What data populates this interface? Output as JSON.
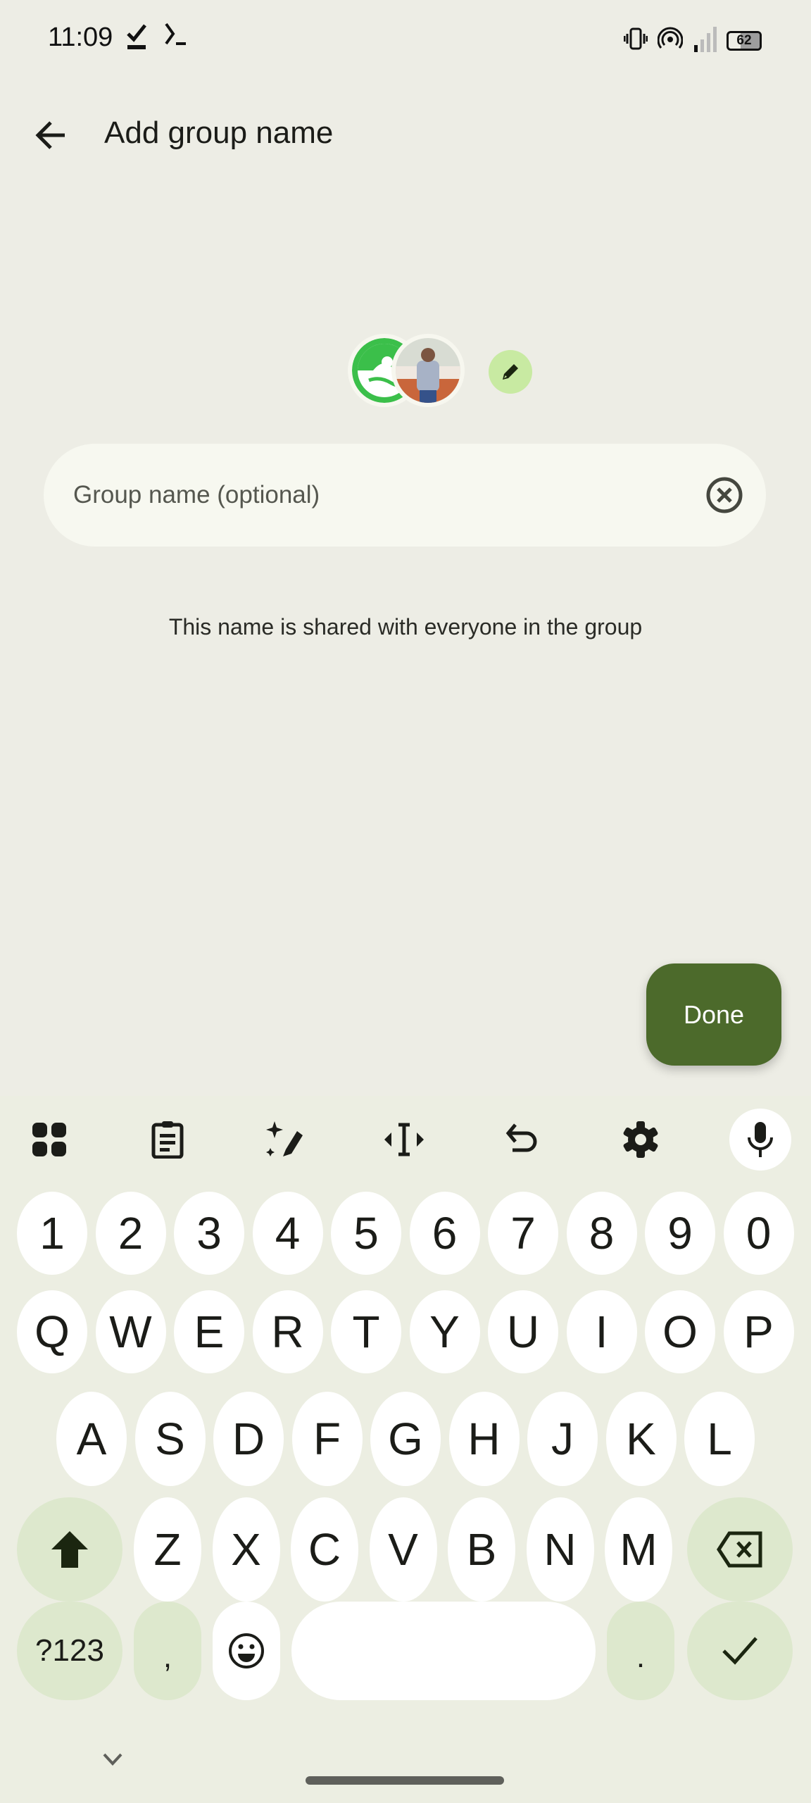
{
  "status_bar": {
    "time": "11:09",
    "left_icons": [
      "task-check-icon",
      "terminal-icon"
    ],
    "right_icons": [
      "vibrate-icon",
      "hotspot-icon",
      "signal-icon",
      "battery-icon"
    ],
    "battery_level": "62"
  },
  "app_bar": {
    "back_icon": "arrow-back-icon",
    "title": "Add group name"
  },
  "avatars": [
    {
      "name": "app-logo-avatar",
      "description": "green robot logo"
    },
    {
      "name": "person-photo-avatar",
      "description": "photo of person"
    }
  ],
  "edit_photo": {
    "icon": "pencil-icon"
  },
  "group_name_field": {
    "value": "",
    "placeholder": "Group name (optional)",
    "clear_icon": "clear-circle-icon"
  },
  "helper_text": "This name is shared with everyone in the group",
  "done_button": {
    "label": "Done"
  },
  "colors": {
    "background": "#edede5",
    "accent": "#4c6a2b",
    "edit_button": "#c8eaa2",
    "key_fn": "#dde8cd",
    "field_bg": "#f7f8f0"
  },
  "keyboard": {
    "toolbar": [
      "apps-grid-icon",
      "clipboard-icon",
      "magic-edit-icon",
      "text-cursor-icon",
      "undo-icon",
      "settings-gear-icon",
      "microphone-icon"
    ],
    "row_numbers": [
      "1",
      "2",
      "3",
      "4",
      "5",
      "6",
      "7",
      "8",
      "9",
      "0"
    ],
    "row_1": [
      "Q",
      "W",
      "E",
      "R",
      "T",
      "Y",
      "U",
      "I",
      "O",
      "P"
    ],
    "row_2": [
      "A",
      "S",
      "D",
      "F",
      "G",
      "H",
      "J",
      "K",
      "L"
    ],
    "row_3": [
      "Z",
      "X",
      "C",
      "V",
      "B",
      "N",
      "M"
    ],
    "shift_icon": "shift-arrow-icon",
    "backspace_icon": "backspace-icon",
    "symbols_label": "?123",
    "comma_label": ",",
    "emoji_icon": "emoji-icon",
    "space_label": "",
    "period_label": ".",
    "enter_icon": "checkmark-icon",
    "collapse_icon": "chevron-down-icon"
  }
}
